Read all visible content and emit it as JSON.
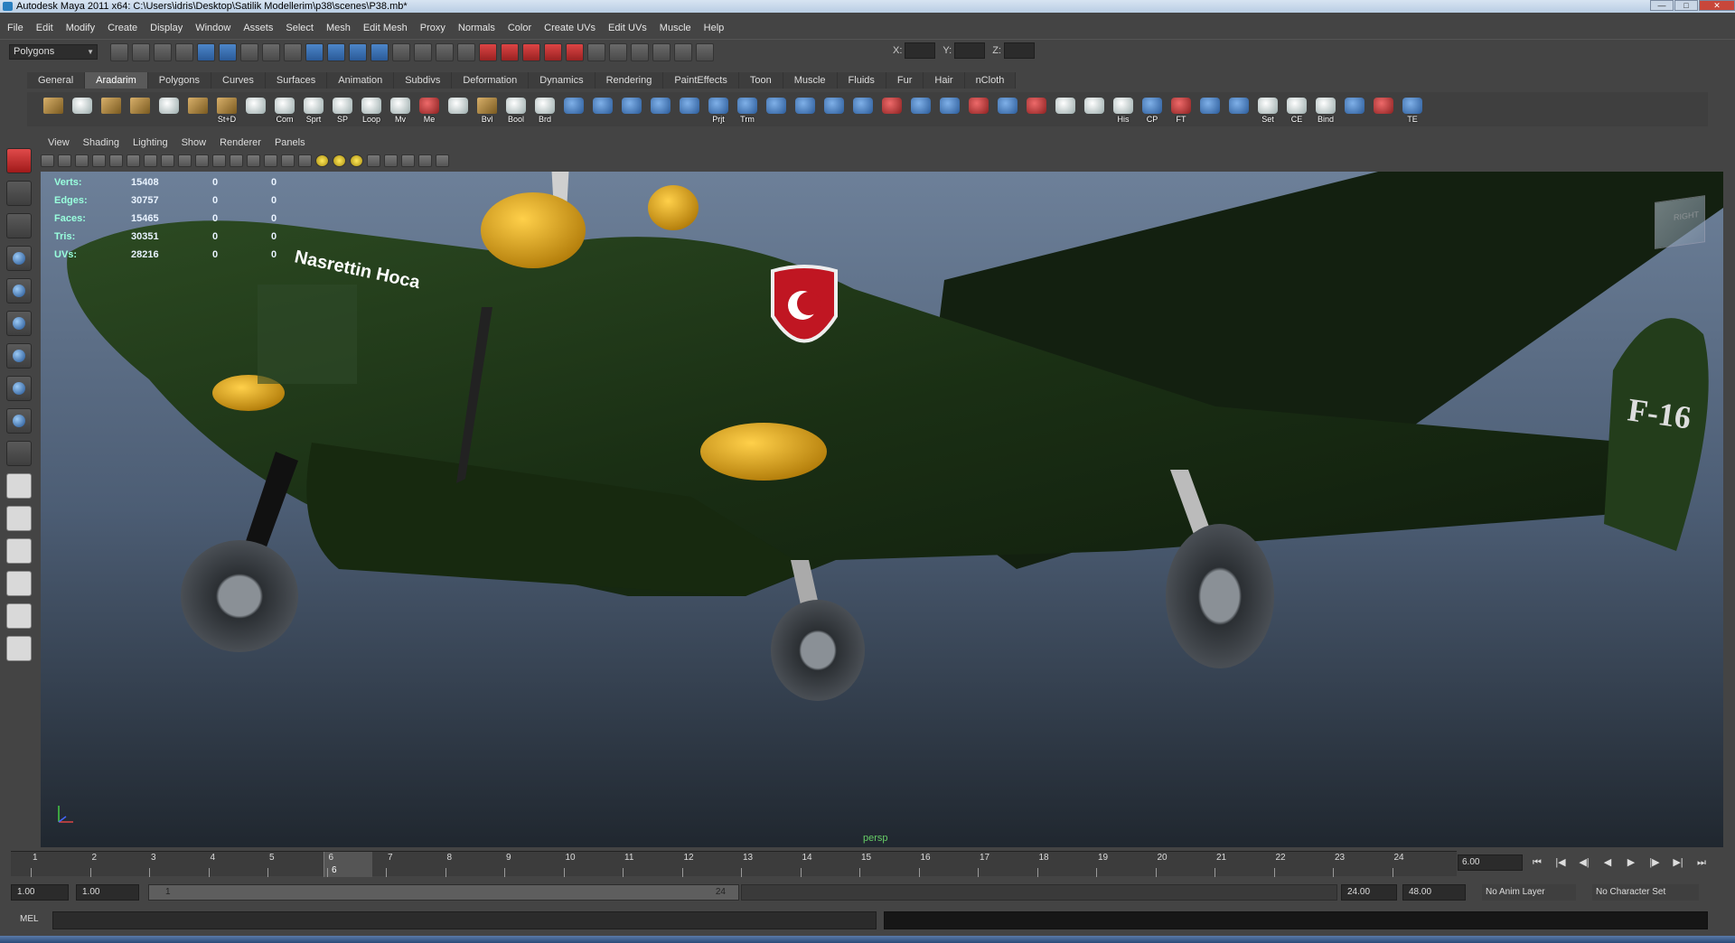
{
  "window": {
    "title": "Autodesk Maya 2011 x64: C:\\Users\\idris\\Desktop\\Satilik Modellerim\\p38\\scenes\\P38.mb*"
  },
  "menu": [
    "File",
    "Edit",
    "Modify",
    "Create",
    "Display",
    "Window",
    "Assets",
    "Select",
    "Mesh",
    "Edit Mesh",
    "Proxy",
    "Normals",
    "Color",
    "Create UVs",
    "Edit UVs",
    "Muscle",
    "Help"
  ],
  "status": {
    "mode": "Polygons",
    "x_label": "X:",
    "y_label": "Y:",
    "z_label": "Z:"
  },
  "shelf_tabs": [
    "General",
    "Aradarim",
    "Polygons",
    "Curves",
    "Surfaces",
    "Animation",
    "Subdivs",
    "Deformation",
    "Dynamics",
    "Rendering",
    "PaintEffects",
    "Toon",
    "Muscle",
    "Fluids",
    "Fur",
    "Hair",
    "nCloth"
  ],
  "shelf_active": "Aradarim",
  "shelf_buttons": [
    "",
    "",
    "",
    "",
    "",
    "",
    "St+D",
    "",
    "Com",
    "Sprt",
    "SP",
    "Loop",
    "Mv",
    "Me",
    "",
    "Bvl",
    "Bool",
    "Brd",
    "",
    "",
    "",
    "",
    "",
    "Prjt",
    "Trm",
    "",
    "",
    "",
    "",
    "",
    "",
    "",
    "",
    "",
    "",
    "",
    "",
    "His",
    "CP",
    "FT",
    "",
    "",
    "Set",
    "CE",
    "Bind",
    "",
    "",
    "TE"
  ],
  "panel_menu": [
    "View",
    "Shading",
    "Lighting",
    "Show",
    "Renderer",
    "Panels"
  ],
  "hud": [
    {
      "k": "Verts:",
      "v": "15408",
      "v2": "0",
      "v3": "0"
    },
    {
      "k": "Edges:",
      "v": "30757",
      "v2": "0",
      "v3": "0"
    },
    {
      "k": "Faces:",
      "v": "15465",
      "v2": "0",
      "v3": "0"
    },
    {
      "k": "Tris:",
      "v": "30351",
      "v2": "0",
      "v3": "0"
    },
    {
      "k": "UVs:",
      "v": "28216",
      "v2": "0",
      "v3": "0"
    }
  ],
  "viewcube_label": "RIGHT",
  "camera_label": "persp",
  "model": {
    "nose_text": "Nasrettin Hoca",
    "tail_text": "F-16",
    "wing_text": ""
  },
  "timeline": {
    "ticks": [
      "1",
      "2",
      "3",
      "4",
      "5",
      "6",
      "7",
      "8",
      "9",
      "10",
      "11",
      "12",
      "13",
      "14",
      "15",
      "16",
      "17",
      "18",
      "19",
      "20",
      "21",
      "22",
      "23",
      "24"
    ],
    "current_frame": "6",
    "current_field": "6.00"
  },
  "range": {
    "start": "1.00",
    "start2": "1.00",
    "bar_start": "1",
    "bar_end": "24",
    "end": "24.00",
    "end2": "48.00",
    "anim_layer": "No Anim Layer",
    "char_set": "No Character Set"
  },
  "command": {
    "label": "MEL"
  },
  "colors": {
    "viewport_top": "#6d8099",
    "viewport_bottom": "#20272f",
    "plane_green": "#1f3a17",
    "spinner_yellow": "#e3a91b"
  }
}
